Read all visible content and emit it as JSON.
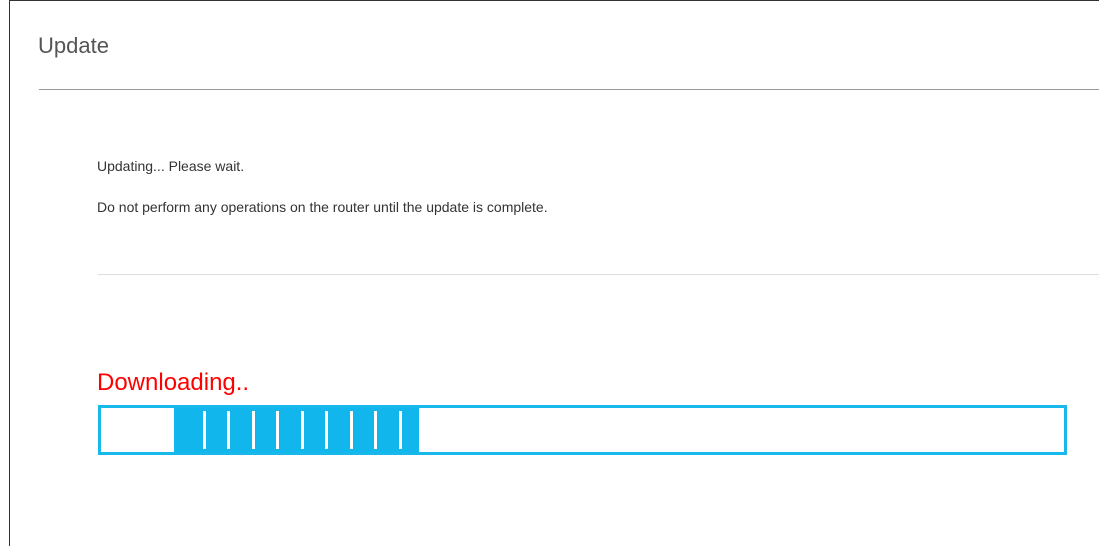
{
  "page": {
    "title": "Update"
  },
  "messages": {
    "line1": "Updating... Please wait.",
    "line2": "Do not perform any operations on the router until the update is complete."
  },
  "progress": {
    "status_text": "Downloading..",
    "fill_start_fraction": 0.076,
    "fill_end_fraction": 0.33,
    "segments": 10,
    "color": "#10b6ec",
    "status_color": "#ff0000"
  }
}
